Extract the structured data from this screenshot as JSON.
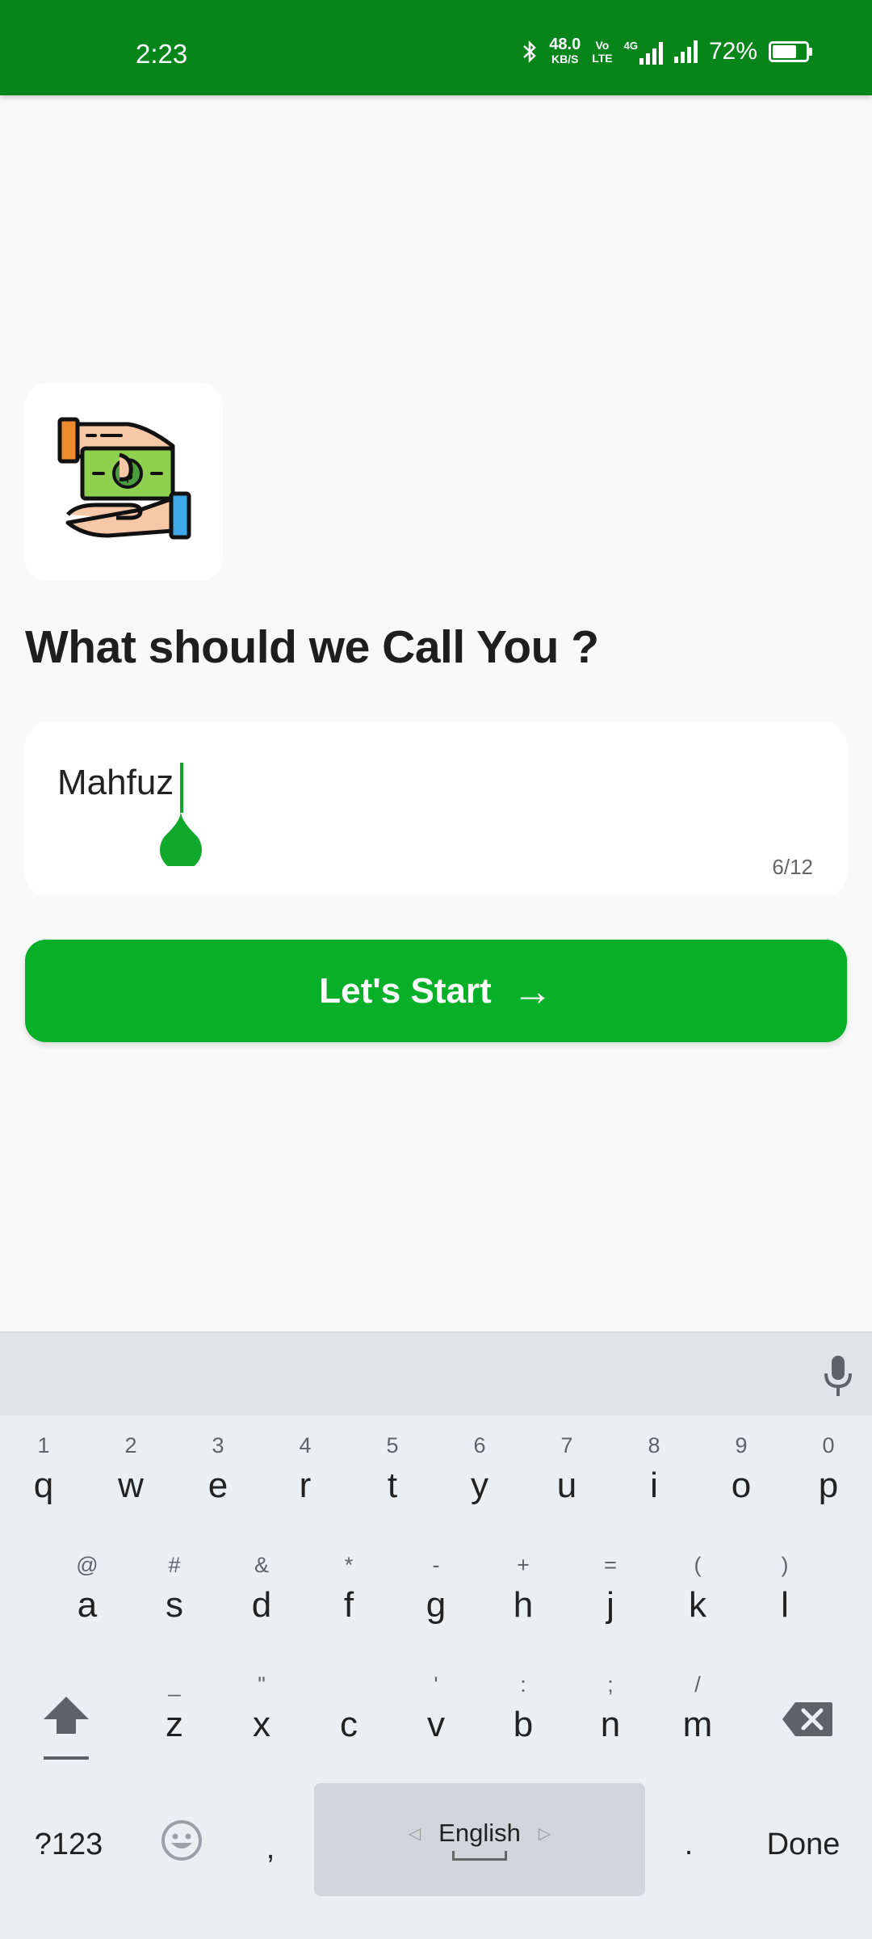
{
  "status_bar": {
    "time": "2:23",
    "net_speed_value": "48.0",
    "net_speed_unit": "KB/S",
    "volte_top": "Vo",
    "volte_bottom": "LTE",
    "network_type": "4G",
    "battery_percent": "72%",
    "battery_level": 0.72
  },
  "app": {
    "icon": "money-exchange-hands-icon",
    "heading": "What should we Call You ?",
    "name_input": {
      "value": "Mahfuz",
      "counter": "6/12"
    },
    "start_button": {
      "label": "Let's Start",
      "arrow": "→"
    },
    "colors": {
      "status_bar": "#07851b",
      "accent": "#08b02a"
    }
  },
  "keyboard": {
    "row1": [
      {
        "key": "q",
        "hint": "1"
      },
      {
        "key": "w",
        "hint": "2"
      },
      {
        "key": "e",
        "hint": "3"
      },
      {
        "key": "r",
        "hint": "4"
      },
      {
        "key": "t",
        "hint": "5"
      },
      {
        "key": "y",
        "hint": "6"
      },
      {
        "key": "u",
        "hint": "7"
      },
      {
        "key": "i",
        "hint": "8"
      },
      {
        "key": "o",
        "hint": "9"
      },
      {
        "key": "p",
        "hint": "0"
      }
    ],
    "row2": [
      {
        "key": "a",
        "hint": "@"
      },
      {
        "key": "s",
        "hint": "#"
      },
      {
        "key": "d",
        "hint": "&"
      },
      {
        "key": "f",
        "hint": "*"
      },
      {
        "key": "g",
        "hint": "-"
      },
      {
        "key": "h",
        "hint": "+"
      },
      {
        "key": "j",
        "hint": "="
      },
      {
        "key": "k",
        "hint": "("
      },
      {
        "key": "l",
        "hint": ")"
      }
    ],
    "row3": [
      {
        "key": "z",
        "hint": "_"
      },
      {
        "key": "x",
        "hint": "\""
      },
      {
        "key": "c",
        "hint": ""
      },
      {
        "key": "v",
        "hint": "'"
      },
      {
        "key": "b",
        "hint": ":"
      },
      {
        "key": "n",
        "hint": ";"
      },
      {
        "key": "m",
        "hint": "/"
      }
    ],
    "symbols_key": "?123",
    "comma_key": ",",
    "space_label": "English",
    "period_key": ".",
    "done_key": "Done"
  }
}
